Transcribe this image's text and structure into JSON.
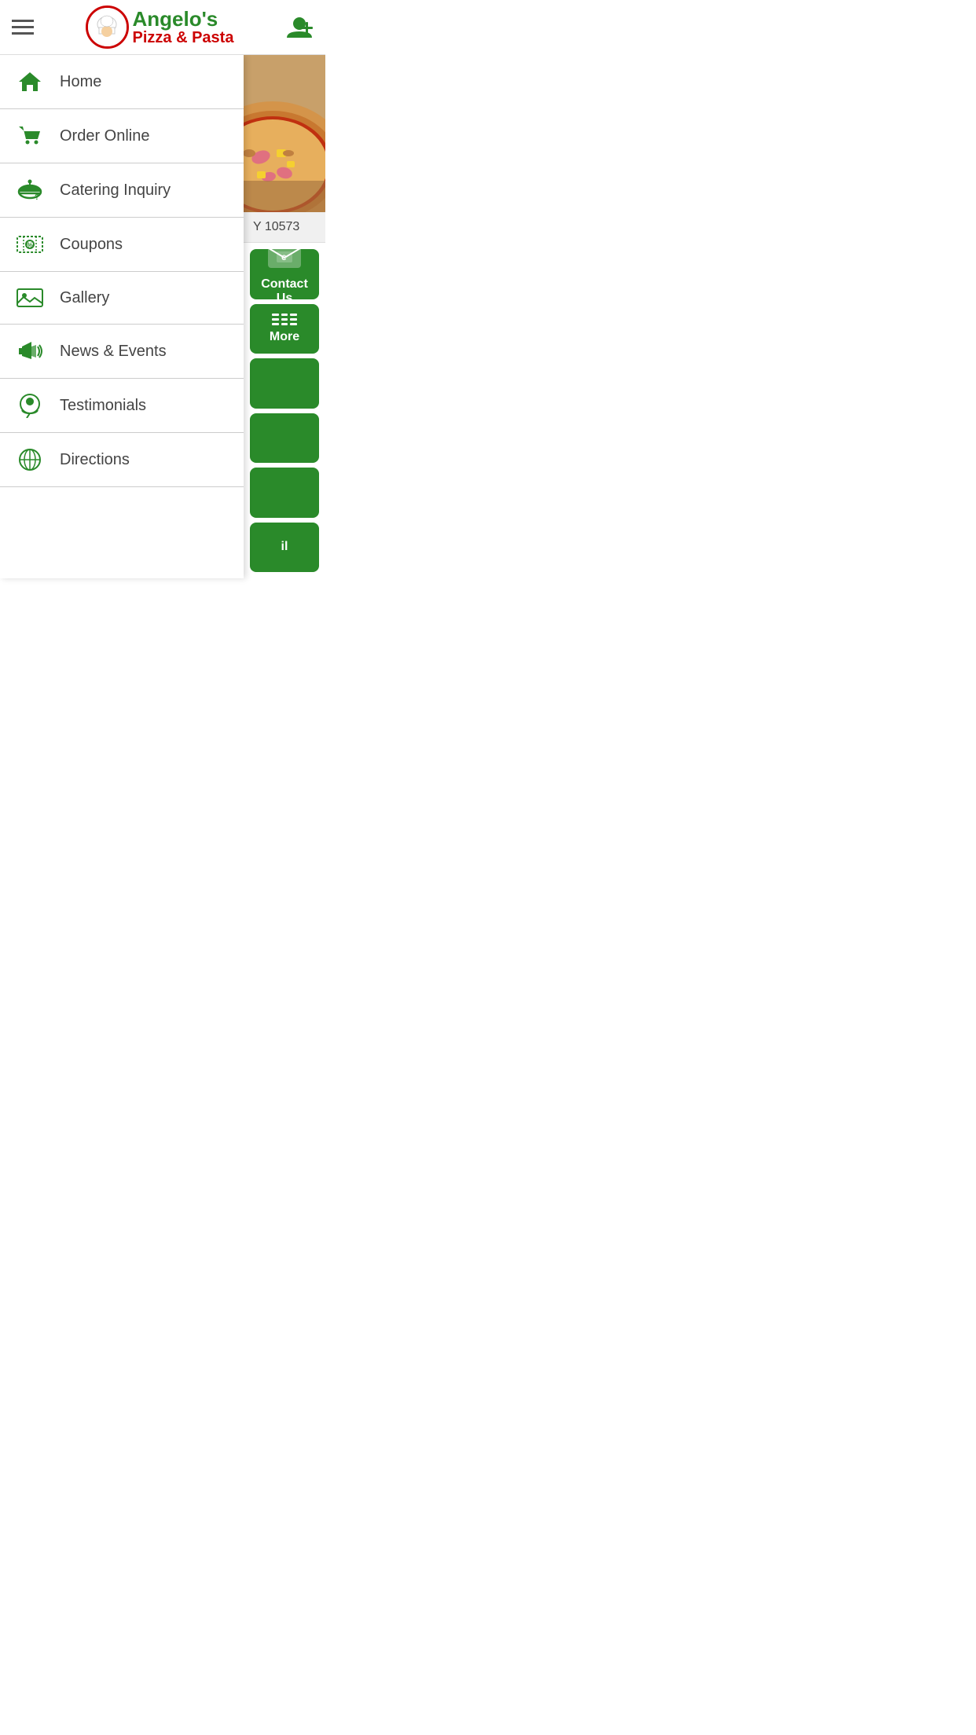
{
  "header": {
    "logo_name": "Angelo's",
    "logo_subtitle": "Pizza & Pasta",
    "logo_emoji": "👨‍🍳"
  },
  "sidebar": {
    "items": [
      {
        "id": "home",
        "label": "Home",
        "icon": "home"
      },
      {
        "id": "order-online",
        "label": "Order Online",
        "icon": "cart"
      },
      {
        "id": "catering-inquiry",
        "label": "Catering Inquiry",
        "icon": "catering"
      },
      {
        "id": "coupons",
        "label": "Coupons",
        "icon": "coupon"
      },
      {
        "id": "gallery",
        "label": "Gallery",
        "icon": "gallery"
      },
      {
        "id": "news-events",
        "label": "News & Events",
        "icon": "news"
      },
      {
        "id": "testimonials",
        "label": "Testimonials",
        "icon": "testimonials"
      },
      {
        "id": "directions",
        "label": "Directions",
        "icon": "directions"
      }
    ]
  },
  "right_panel": {
    "address": "Y 10573",
    "buttons": [
      {
        "id": "contact-us",
        "label": "Contact Us",
        "icon": "email"
      },
      {
        "id": "more",
        "label": "More",
        "icon": "grid"
      },
      {
        "id": "btn3",
        "label": "",
        "icon": ""
      },
      {
        "id": "btn4",
        "label": "",
        "icon": ""
      },
      {
        "id": "btn5",
        "label": "",
        "icon": ""
      },
      {
        "id": "btn6",
        "label": "il",
        "icon": ""
      }
    ]
  }
}
